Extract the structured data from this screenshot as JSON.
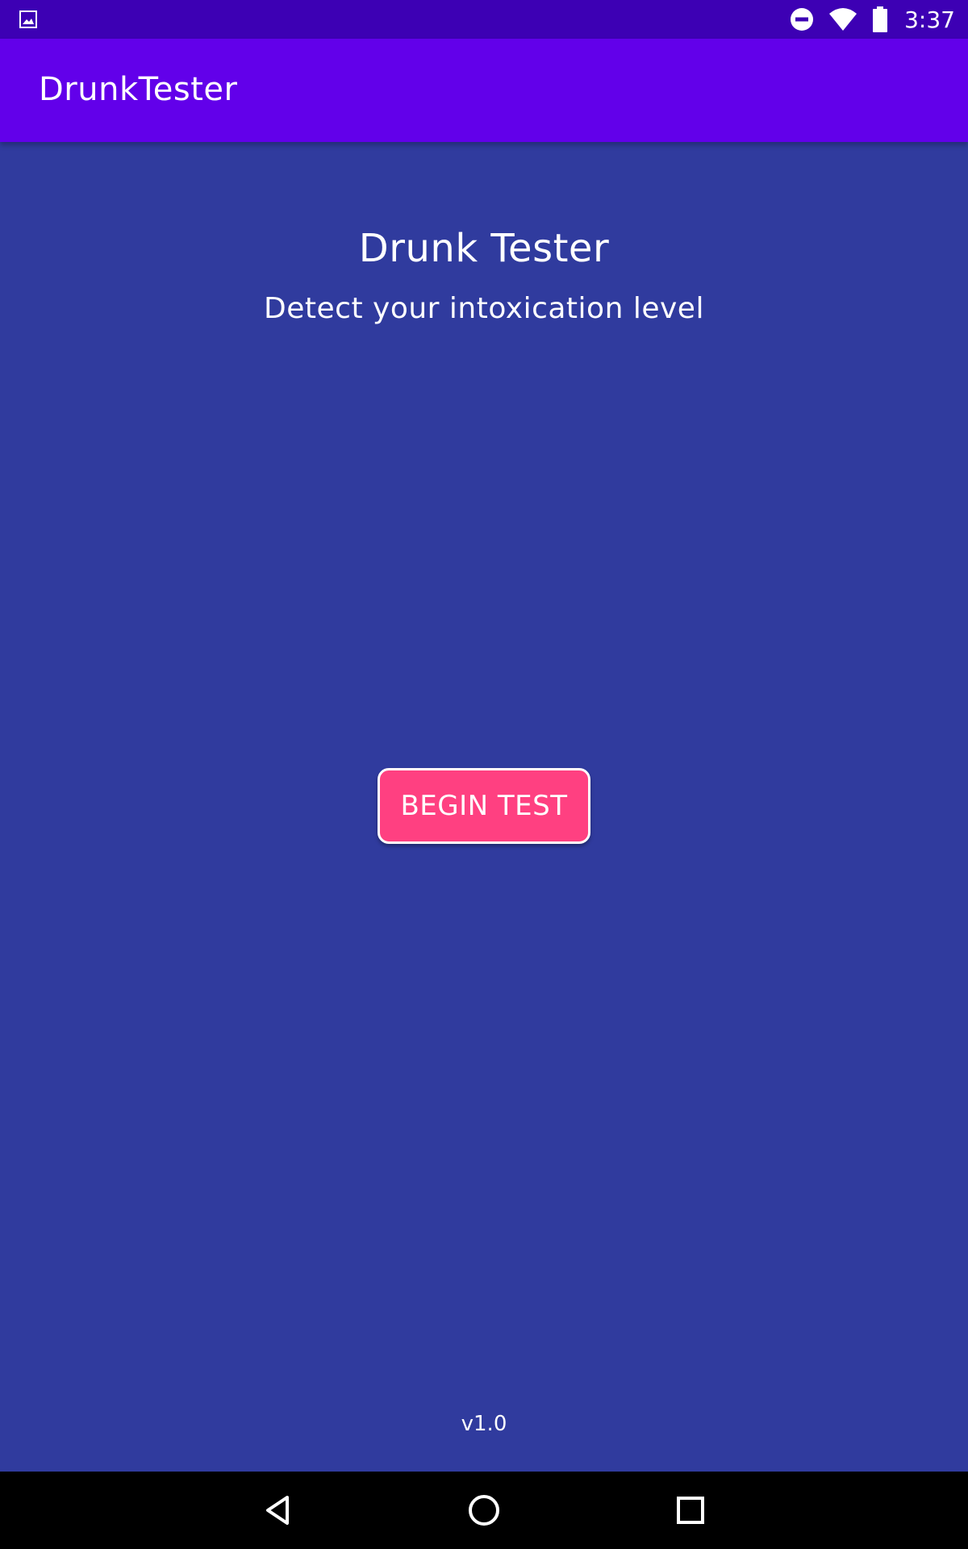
{
  "status_bar": {
    "time": "3:37",
    "left_icon": "image-notification-icon",
    "icons": [
      "do-not-disturb-icon",
      "wifi-icon",
      "battery-icon"
    ]
  },
  "app_bar": {
    "title": "DrunkTester"
  },
  "main": {
    "title": "Drunk Tester",
    "subtitle": "Detect your intoxication level",
    "begin_button_label": "BEGIN TEST",
    "version": "v1.0"
  },
  "nav_bar": {
    "buttons": [
      "back-icon",
      "home-icon",
      "recents-icon"
    ]
  },
  "colors": {
    "status_bar": "#3d00b4",
    "app_bar": "#6200ea",
    "background": "#303b9e",
    "button": "#ff4081",
    "text": "#ffffff"
  }
}
